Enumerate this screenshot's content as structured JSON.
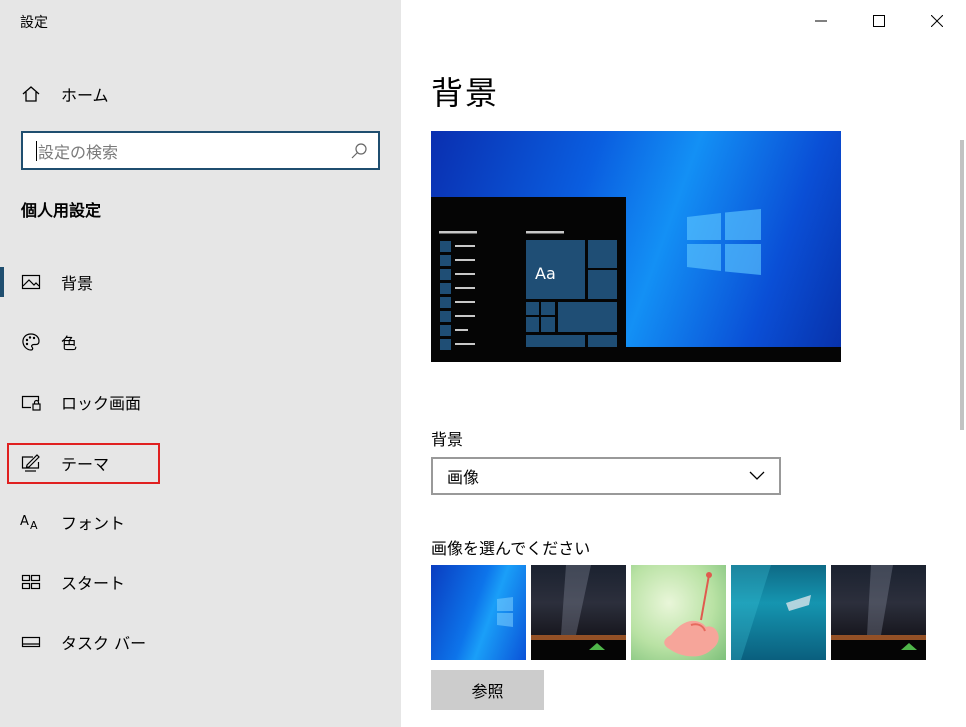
{
  "window": {
    "title": "設定"
  },
  "sidebar": {
    "home_label": "ホーム",
    "search": {
      "placeholder": "設定の検索"
    },
    "section_title": "個人用設定",
    "items": [
      {
        "label": "背景",
        "icon": "picture-icon",
        "active": true
      },
      {
        "label": "色",
        "icon": "palette-icon",
        "active": false
      },
      {
        "label": "ロック画面",
        "icon": "lock-screen-icon",
        "active": false
      },
      {
        "label": "テーマ",
        "icon": "theme-icon",
        "active": false,
        "highlighted": true
      },
      {
        "label": "フォント",
        "icon": "font-icon",
        "active": false
      },
      {
        "label": "スタート",
        "icon": "start-icon",
        "active": false
      },
      {
        "label": "タスク バー",
        "icon": "taskbar-icon",
        "active": false
      }
    ]
  },
  "main": {
    "page_title": "背景",
    "preview": {
      "tile_label": "Aa"
    },
    "background": {
      "label": "背景",
      "selected": "画像"
    },
    "choose_label": "画像を選んでください",
    "browse_label": "参照"
  },
  "colors": {
    "accent": "#1f4e6f",
    "highlight": "#e02020",
    "sidebar_bg": "#e6e6e6"
  }
}
